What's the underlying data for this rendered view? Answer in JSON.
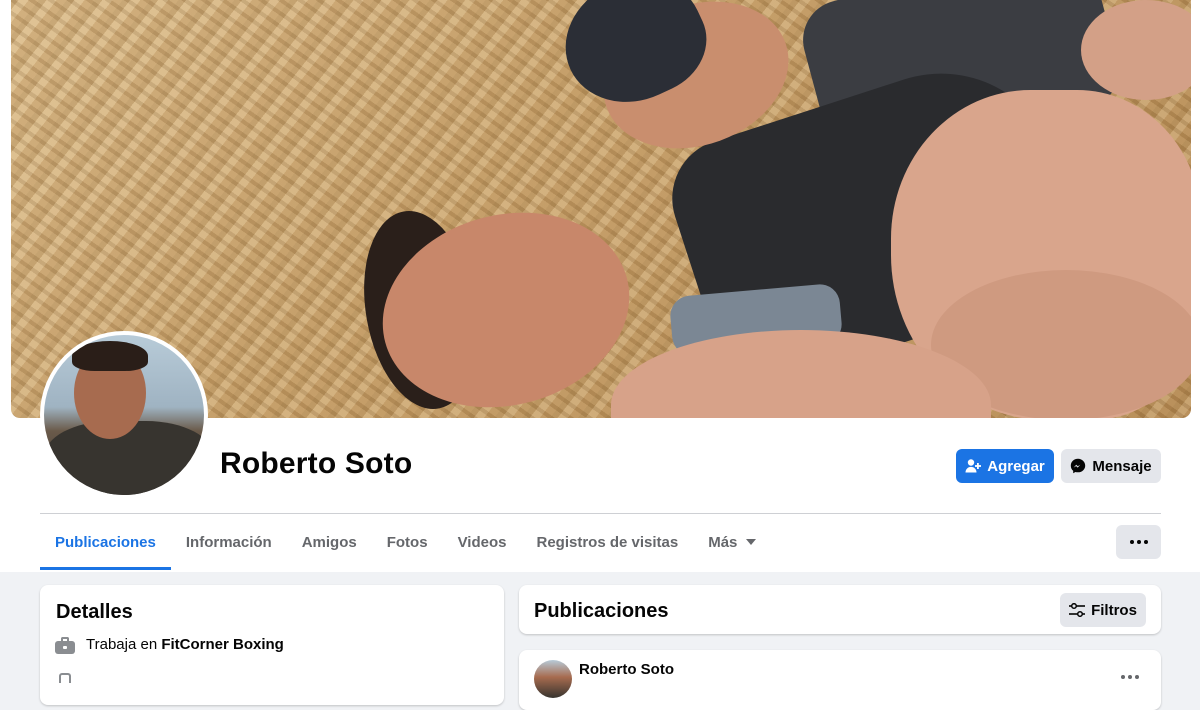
{
  "profile": {
    "name": "Roberto Soto"
  },
  "actions": {
    "add_friend_label": "Agregar",
    "message_label": "Mensaje"
  },
  "tabs": [
    {
      "label": "Publicaciones",
      "active": true
    },
    {
      "label": "Información",
      "active": false
    },
    {
      "label": "Amigos",
      "active": false
    },
    {
      "label": "Fotos",
      "active": false
    },
    {
      "label": "Videos",
      "active": false
    },
    {
      "label": "Registros de visitas",
      "active": false
    },
    {
      "label": "Más",
      "active": false,
      "has_caret": true
    }
  ],
  "details": {
    "title": "Detalles",
    "work_prefix": "Trabaja en",
    "work_place": "FitCorner Boxing"
  },
  "posts": {
    "title": "Publicaciones",
    "filter_label": "Filtros",
    "first_post_author": "Roberto Soto"
  },
  "icons": {
    "add_friend": "person-add-icon",
    "message": "messenger-icon",
    "more": "more-horizontal-icon",
    "filter": "sliders-icon",
    "work": "briefcase-icon",
    "dropdown": "caret-down-icon"
  },
  "colors": {
    "accent": "#1b74e4",
    "page_bg": "#f0f2f5",
    "button_gray": "#e4e6eb",
    "muted_text": "#65676b"
  }
}
